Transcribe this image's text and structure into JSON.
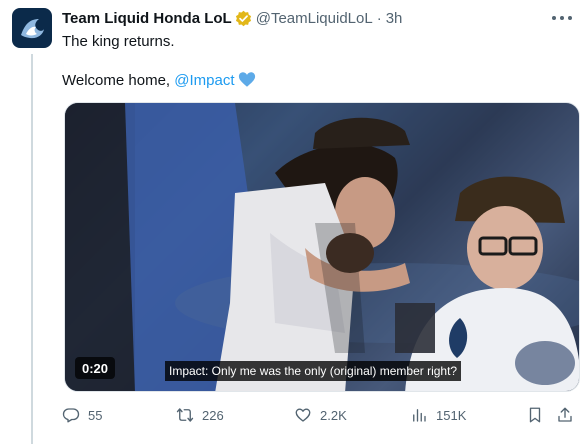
{
  "tweet": {
    "author_name": "Team Liquid Honda LoL",
    "handle": "@TeamLiquidLoL",
    "separator": "·",
    "time": "3h",
    "line1": "The king returns.",
    "line2_prefix": "Welcome home, ",
    "mention": "@Impact",
    "verified_color": "#e2b719",
    "mention_color": "#1d9bf0"
  },
  "media": {
    "duration": "0:20",
    "caption": "Impact: Only me was the only (original) member right?"
  },
  "actions": {
    "replies": "55",
    "retweets": "226",
    "likes": "2.2K",
    "views": "151K"
  }
}
